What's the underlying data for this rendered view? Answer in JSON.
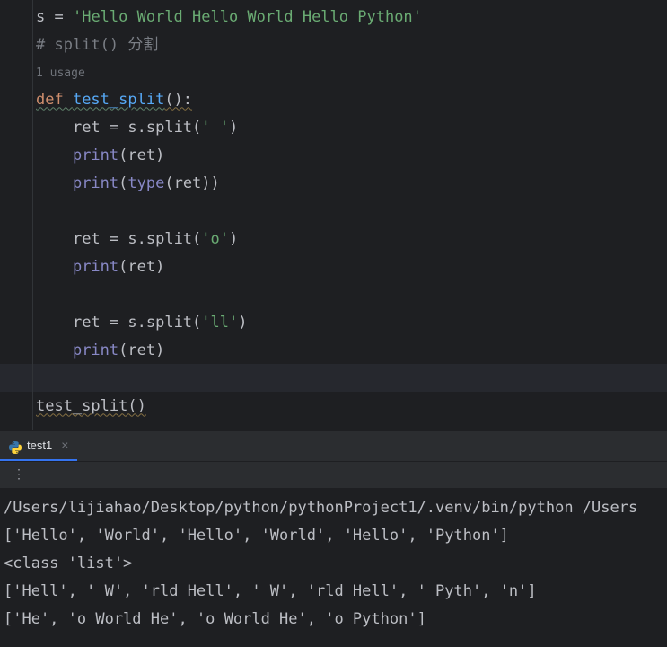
{
  "editor": {
    "lines": {
      "l1_var": "s ",
      "l1_op": "= ",
      "l1_str": "'Hello World Hello World Hello Python'",
      "l2_comment": "# split() 分割",
      "l3_usage": "1 usage",
      "l4_def": "def ",
      "l4_name": "test_split",
      "l4_paren": "():",
      "l5_indent": "    ",
      "l5_code1": "ret ",
      "l5_op": "= ",
      "l5_code2": "s.split(",
      "l5_str": "' '",
      "l5_close": ")",
      "l6_indent": "    ",
      "l6_print": "print",
      "l6_args": "(ret)",
      "l7_indent": "    ",
      "l7_print": "print",
      "l7_open": "(",
      "l7_type": "type",
      "l7_args": "(ret))",
      "l8_indent": "    ",
      "l8_code1": "ret ",
      "l8_op": "= ",
      "l8_code2": "s.split(",
      "l8_str": "'o'",
      "l8_close": ")",
      "l9_indent": "    ",
      "l9_print": "print",
      "l9_args": "(ret)",
      "l10_indent": "    ",
      "l10_code1": "ret ",
      "l10_op": "= ",
      "l10_code2": "s.split(",
      "l10_str": "'ll'",
      "l10_close": ")",
      "l11_indent": "    ",
      "l11_print": "print",
      "l11_args": "(ret)",
      "l12_call": "test_split()"
    }
  },
  "run": {
    "tab_name": "test1",
    "console_lines": {
      "c1": "/Users/lijiahao/Desktop/python/pythonProject1/.venv/bin/python /Users",
      "c2": "['Hello', 'World', 'Hello', 'World', 'Hello', 'Python']",
      "c3": "<class 'list'>",
      "c4": "['Hell', ' W', 'rld Hell', ' W', 'rld Hell', ' Pyth', 'n']",
      "c5": "['He', 'o World He', 'o World He', 'o Python']"
    }
  }
}
